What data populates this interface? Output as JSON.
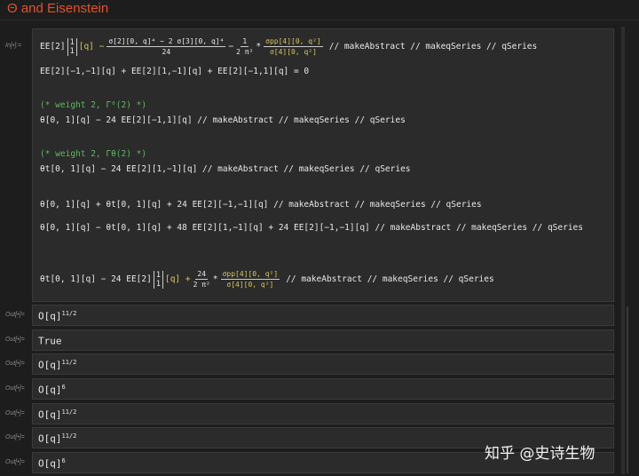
{
  "title": "Θ and Eisenstein",
  "in_label": "In[•]:=",
  "out_label": "Out[•]=",
  "input": {
    "l1_a": "EE[2]",
    "l1_m_top": "1",
    "l1_m_bot": "1",
    "l1_b": "[q] −",
    "l1_f1_num": "σ[2][0, q]⁴ − 2 σ[3][0, q]⁴",
    "l1_f1_den": "24",
    "l1_f2_num": "1",
    "l1_f2_den": "2 π²",
    "l1_f3_num": "σpp[4][0, q²]",
    "l1_f3_den": "σ[4][0, q²]",
    "l1_tail": "// makeAbstract // makeqSeries // qSeries",
    "l2": "EE[2][−1,−1][q] + EE[2][1,−1][q] + EE[2][−1,1][q] = 0",
    "c1": "(* weight 2, Γ⁰(2) *)",
    "l3": "θ[0, 1][q] − 24 EE[2][−1,1][q] // makeAbstract // makeqSeries // qSeries",
    "c2": "(* weight 2, Γθ(2) *)",
    "l4": "θt[0, 1][q] − 24 EE[2][1,−1][q] // makeAbstract // makeqSeries // qSeries",
    "l5": "θ[0, 1][q] + θt[0, 1][q] + 24 EE[2][−1,−1][q] // makeAbstract // makeqSeries // qSeries",
    "l6": "θ[0, 1][q] − θt[0, 1][q] + 48 EE[2][1,−1][q] + 24 EE[2][−1,−1][q] // makeAbstract // makeqSeries // qSeries",
    "l7_a": "θt[0, 1][q] − 24 EE[2]",
    "l7_m_top": "1",
    "l7_m_bot": "1",
    "l7_b": "[q] +",
    "l7_f1_num": "24",
    "l7_f1_den": "2 π²",
    "l7_f2_num": "σpp[4][0, q²]",
    "l7_f2_den": "σ[4][0, q²]",
    "l7_tail": "// makeAbstract // makeqSeries // qSeries"
  },
  "outputs": [
    {
      "base": "O[q]",
      "exp": "11/2"
    },
    {
      "base": "True",
      "exp": ""
    },
    {
      "base": "O[q]",
      "exp": "11/2"
    },
    {
      "base": "O[q]",
      "exp": "6"
    },
    {
      "base": "O[q]",
      "exp": "11/2"
    },
    {
      "base": "O[q]",
      "exp": "11/2"
    },
    {
      "base": "O[q]",
      "exp": "6"
    }
  ],
  "watermark": "知乎 @史诗生物"
}
